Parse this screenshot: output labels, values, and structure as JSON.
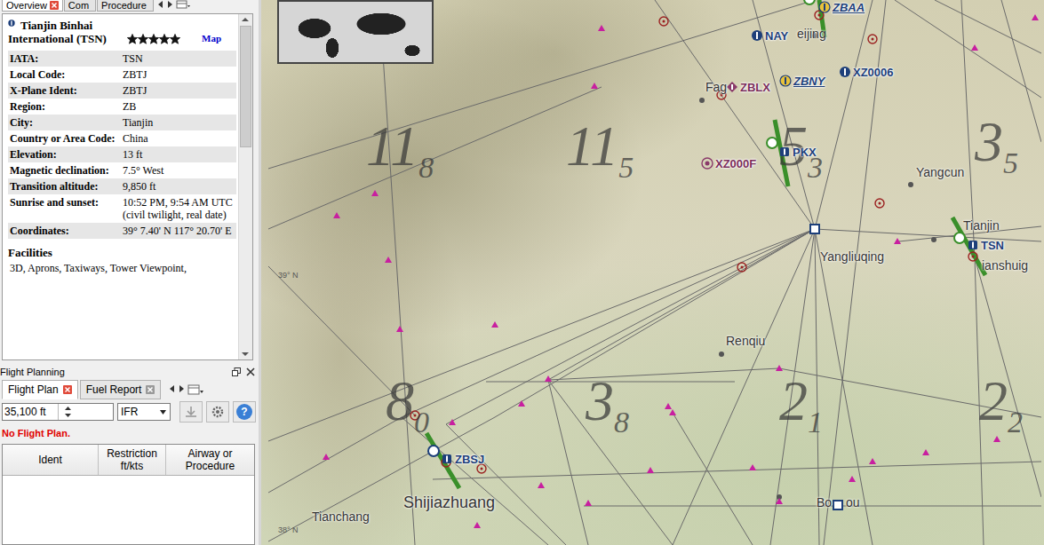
{
  "overview_tabs": [
    {
      "label": "Overview",
      "selected": true,
      "closable": true
    },
    {
      "label": "Com",
      "selected": false,
      "closable": false
    },
    {
      "label": "Procedure",
      "selected": false,
      "closable": false
    }
  ],
  "airport": {
    "name": "Tianjin Binhai International (TSN)",
    "stars": 5,
    "map_link": "Map",
    "fields": [
      {
        "label": "IATA:",
        "value": "TSN"
      },
      {
        "label": "Local Code:",
        "value": "ZBTJ"
      },
      {
        "label": "X-Plane Ident:",
        "value": "ZBTJ"
      },
      {
        "label": "Region:",
        "value": "ZB"
      },
      {
        "label": "City:",
        "value": "Tianjin"
      },
      {
        "label": "Country or Area Code:",
        "value": "China"
      },
      {
        "label": "Elevation:",
        "value": "13 ft"
      },
      {
        "label": "Magnetic declination:",
        "value": "7.5° West"
      },
      {
        "label": "Transition altitude:",
        "value": "9,850 ft"
      },
      {
        "label": "Sunrise and sunset:",
        "value": "10:52 PM, 9:54 AM UTC (civil twilight, real date)"
      },
      {
        "label": "Coordinates:",
        "value": "39° 7.40' N 117° 20.70' E"
      }
    ],
    "facilities_title": "Facilities",
    "facilities": "3D, Aprons, Taxiways, Tower Viewpoint,"
  },
  "flight_planning": {
    "title": "Flight Planning",
    "tabs": [
      {
        "label": "Flight Plan",
        "selected": true,
        "closable": true
      },
      {
        "label": "Fuel Report",
        "selected": false,
        "closable": true
      }
    ],
    "altitude": "35,100 ft",
    "flight_rules": "IFR",
    "help": "?",
    "status": "No Flight Plan.",
    "columns": [
      "Ident",
      "Restriction ft/kts",
      "Airway or Procedure"
    ]
  },
  "map": {
    "labels": [
      {
        "text": "ZBAA",
        "kind": "addon",
        "color": "#1d3f7a"
      },
      {
        "text": "NAY",
        "kind": "vor",
        "color": "#1d3f7a"
      },
      {
        "text": "eijing",
        "kind": "city",
        "color": "#333333"
      },
      {
        "text": "ZBLX",
        "kind": "closed",
        "color": "#7a2d5a"
      },
      {
        "text": "Fag",
        "kind": "city",
        "color": "#333333"
      },
      {
        "text": "ZBNY",
        "kind": "addon",
        "color": "#1d3f7a"
      },
      {
        "text": "XZ0006",
        "kind": "vor",
        "color": "#1d3f7a"
      },
      {
        "text": "PKX",
        "kind": "airport",
        "color": "#1d3f7a"
      },
      {
        "text": "XZ000F",
        "kind": "ndb",
        "color": "#7a2d5a"
      },
      {
        "text": "Yangcun",
        "kind": "city",
        "color": "#333333"
      },
      {
        "text": "Yangliuqing",
        "kind": "city",
        "color": "#333333"
      },
      {
        "text": "Tianjin",
        "kind": "city",
        "color": "#333333"
      },
      {
        "text": "TSN",
        "kind": "airport",
        "color": "#1d3f7a"
      },
      {
        "text": "ianshuig",
        "kind": "city",
        "color": "#333333"
      },
      {
        "text": "Renqiu",
        "kind": "city",
        "color": "#333333"
      },
      {
        "text": "ZBSJ",
        "kind": "airport",
        "color": "#1d3f7a"
      },
      {
        "text": "Shijiazhuang",
        "kind": "bigcity",
        "color": "#333333"
      },
      {
        "text": "Tianchang",
        "kind": "city",
        "color": "#333333"
      },
      {
        "text": "Bo",
        "kind": "city",
        "color": "#333333"
      },
      {
        "text": "ou",
        "kind": "city",
        "color": "#333333"
      }
    ],
    "mora": [
      {
        "main": "11",
        "sub": "8"
      },
      {
        "main": "11",
        "sub": "5"
      },
      {
        "main": "5",
        "sub": "3"
      },
      {
        "main": "3",
        "sub": "5"
      },
      {
        "main": "8",
        "sub": "0"
      },
      {
        "main": "3",
        "sub": "8"
      },
      {
        "main": "2",
        "sub": "1"
      },
      {
        "main": "2",
        "sub": "2"
      }
    ],
    "latitudes": [
      "39° N",
      "38° N"
    ]
  }
}
